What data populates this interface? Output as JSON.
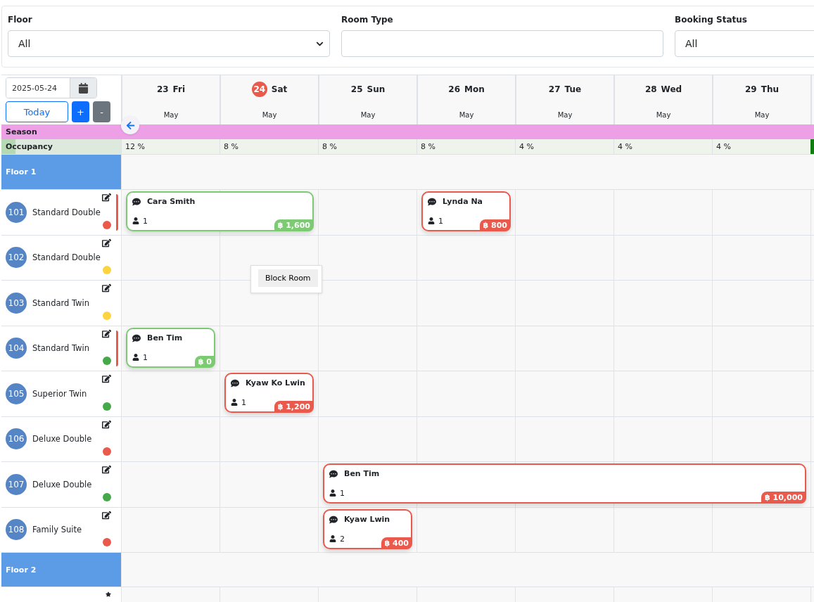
{
  "filters": [
    {
      "label": "Floor",
      "kind": "select",
      "value": "All"
    },
    {
      "label": "Room Type",
      "kind": "input"
    },
    {
      "label": "Booking Status",
      "kind": "select",
      "value": "All"
    }
  ],
  "toolbar": {
    "date": "2025-05-24",
    "today": "Today",
    "zoom_in": "+",
    "zoom_out": "-"
  },
  "days": [
    {
      "day": "23",
      "weekday": "Fri",
      "month": "May",
      "today": false
    },
    {
      "day": "24",
      "weekday": "Sat",
      "month": "May",
      "today": true
    },
    {
      "day": "25",
      "weekday": "Sun",
      "month": "May",
      "today": false
    },
    {
      "day": "26",
      "weekday": "Mon",
      "month": "May",
      "today": false
    },
    {
      "day": "27",
      "weekday": "Tue",
      "month": "May",
      "today": false
    },
    {
      "day": "28",
      "weekday": "Wed",
      "month": "May",
      "today": false
    },
    {
      "day": "29",
      "weekday": "Thu",
      "month": "May",
      "today": false
    }
  ],
  "season": {
    "label": "Season"
  },
  "occupancy": {
    "label": "Occupancy",
    "level": 0.12,
    "values": [
      "12 %",
      "8 %",
      "8 %",
      "8 %",
      "4 %",
      "4 %",
      "4 %"
    ]
  },
  "floors": [
    {
      "name": "Floor 1",
      "rooms": [
        {
          "number": "101",
          "type": "Standard Double",
          "color": "#e9594c",
          "flagged": true,
          "bookings": [
            {
              "guest": "Cara Smith",
              "guests": "1",
              "price": "฿ 1,600",
              "color": "#7ccb73"
            },
            {
              "guest": "Lynda Na",
              "guests": "1",
              "price": "฿ 800",
              "color": "#e9594c"
            }
          ]
        },
        {
          "number": "102",
          "type": "Standard Double",
          "color": "#fdd43f",
          "flagged": false
        },
        {
          "number": "103",
          "type": "Standard Twin",
          "color": "#fdd43f",
          "flagged": false
        },
        {
          "number": "104",
          "type": "Standard Twin",
          "color": "#45a94a",
          "flagged": true,
          "bookings": [
            {
              "guest": "Ben Tim",
              "guests": "1",
              "price": "฿ 0",
              "color": "#7ccb73"
            }
          ]
        },
        {
          "number": "105",
          "type": "Superior Twin",
          "color": "#45a94a",
          "flagged": false,
          "bookings": [
            {
              "guest": "Kyaw Ko Lwin",
              "guests": "1",
              "price": "฿ 1,200",
              "color": "#e9594c"
            }
          ]
        },
        {
          "number": "106",
          "type": "Deluxe Double",
          "color": "#e9594c",
          "flagged": false
        },
        {
          "number": "107",
          "type": "Deluxe Double",
          "color": "#45a94a",
          "flagged": false,
          "bookings": [
            {
              "guest": "Ben Tim",
              "guests": "1",
              "price": "฿ 10,000",
              "color": "#e9594c"
            }
          ]
        },
        {
          "number": "108",
          "type": "Family Suite",
          "color": "#e9594c",
          "flagged": false,
          "bookings": [
            {
              "guest": "Kyaw Lwin",
              "guests": "2",
              "price": "฿ 400",
              "color": "#e9594c"
            }
          ]
        }
      ]
    },
    {
      "name": "Floor 2"
    }
  ],
  "context_menu": {
    "item": "Block Room"
  }
}
